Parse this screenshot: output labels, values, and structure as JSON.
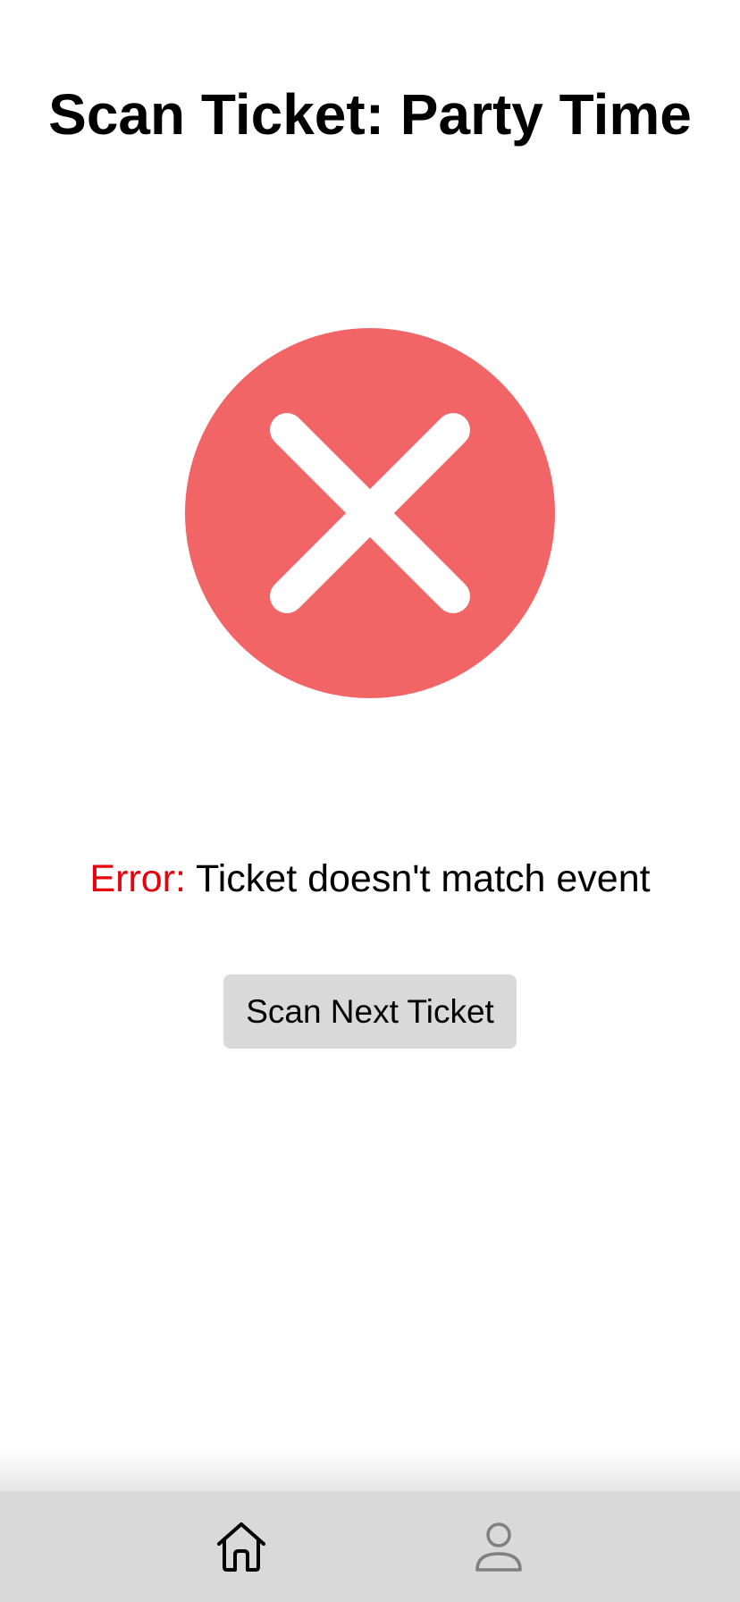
{
  "header": {
    "title": "Scan Ticket: Party Time"
  },
  "status": {
    "icon": "error-x-icon",
    "icon_color": "#f26566",
    "error_label": "Error:",
    "error_label_color": "#e8000b",
    "message": " Ticket doesn't match event"
  },
  "actions": {
    "scan_next_label": "Scan Next Ticket"
  },
  "bottom_nav": {
    "background": "#d9d9d9",
    "items": [
      {
        "icon": "home-icon",
        "active": true
      },
      {
        "icon": "profile-icon",
        "active": false
      }
    ]
  }
}
